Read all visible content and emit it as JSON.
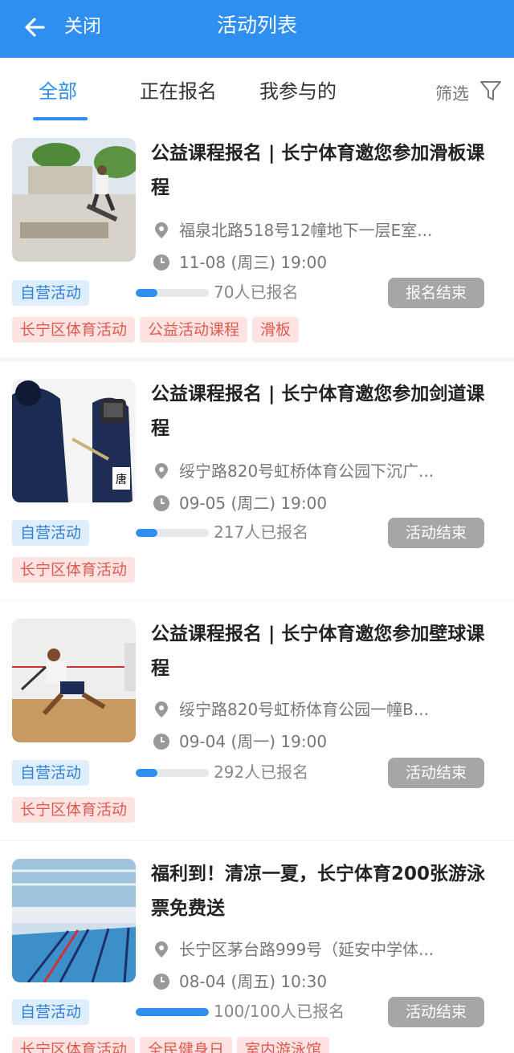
{
  "header": {
    "close_label": "关闭",
    "title": "活动列表"
  },
  "tabs": [
    {
      "label": "全部",
      "active": true
    },
    {
      "label": "正在报名",
      "active": false
    },
    {
      "label": "我参与的",
      "active": false
    }
  ],
  "filter": {
    "label": "筛选",
    "icon": "filter-icon"
  },
  "colors": {
    "primary": "#2f8ff0",
    "status_button": "#a6a6a6",
    "tag_bg": "#fde3e1",
    "tag_text": "#e15a4f",
    "own_bg": "#dfeefd"
  },
  "activities": [
    {
      "title": "公益课程报名 | 长宁体育邀您参加滑板课程",
      "location": "福泉北路518号12幢地下一层E室...",
      "time": "11-08 (周三) 19:00",
      "own_badge": "自营活动",
      "progress": 0.3,
      "count": "70人已报名",
      "status": "报名结束",
      "tags": [
        "长宁区体育活动",
        "公益活动课程",
        "滑板"
      ],
      "image": "skateboard-photo"
    },
    {
      "title": "公益课程报名 | 长宁体育邀您参加剑道课程",
      "location": "绥宁路820号虹桥体育公园下沉广...",
      "time": "09-05 (周二) 19:00",
      "own_badge": "自营活动",
      "progress": 0.3,
      "count": "217人已报名",
      "status": "活动结束",
      "tags": [
        "长宁区体育活动"
      ],
      "image": "kendo-photo"
    },
    {
      "title": "公益课程报名 | 长宁体育邀您参加壁球课程",
      "location": "绥宁路820号虹桥体育公园一幢B...",
      "time": "09-04 (周一) 19:00",
      "own_badge": "自营活动",
      "progress": 0.3,
      "count": "292人已报名",
      "status": "活动结束",
      "tags": [
        "长宁区体育活动"
      ],
      "image": "squash-photo"
    },
    {
      "title": "福利到！清凉一夏，长宁体育200张游泳票免费送",
      "location": "长宁区茅台路999号（延安中学体...",
      "time": "08-04 (周五) 10:30",
      "own_badge": "自营活动",
      "progress": 1.0,
      "count": "100/100人已报名",
      "status": "活动结束",
      "tags": [
        "长宁区体育活动",
        "全民健身日",
        "室内游泳馆"
      ],
      "image": "swimming-pool-photo"
    }
  ]
}
